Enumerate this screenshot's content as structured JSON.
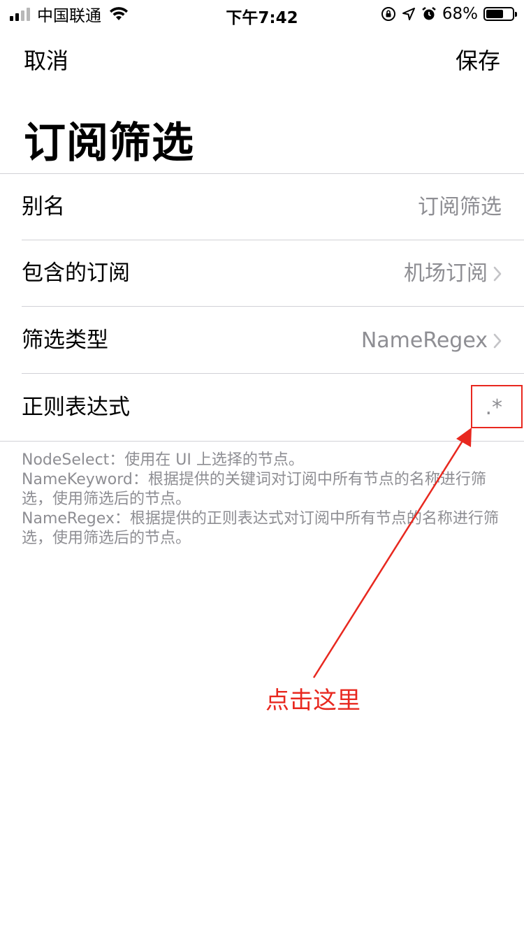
{
  "status_bar": {
    "carrier": "中国联通",
    "time": "下午7:42",
    "battery_percent": "68%",
    "battery_level": 0.68,
    "signal_bars": 4,
    "signal_bars_active": 2,
    "icons": [
      "wifi-icon",
      "orientation-lock-icon",
      "location-icon",
      "alarm-icon",
      "battery-icon"
    ]
  },
  "nav": {
    "cancel": "取消",
    "save": "保存"
  },
  "title": "订阅筛选",
  "rows": [
    {
      "label": "别名",
      "value": "订阅筛选",
      "chevron": false
    },
    {
      "label": "包含的订阅",
      "value": "机场订阅",
      "chevron": true
    },
    {
      "label": "筛选类型",
      "value": "NameRegex",
      "chevron": true
    },
    {
      "label": "正则表达式",
      "value": ".*",
      "chevron": false
    }
  ],
  "footnote": [
    "NodeSelect：使用在 UI 上选择的节点。",
    "NameKeyword：根据提供的关键词对订阅中所有节点的名称进行筛选，使用筛选后的节点。",
    "NameRegex：根据提供的正则表达式对订阅中所有节点的名称进行筛选，使用筛选后的节点。"
  ],
  "annotation": {
    "text": "点击这里",
    "color": "#e8281f"
  },
  "colors": {
    "secondary_text": "#8e8e93",
    "separator": "#d1d1d6"
  }
}
